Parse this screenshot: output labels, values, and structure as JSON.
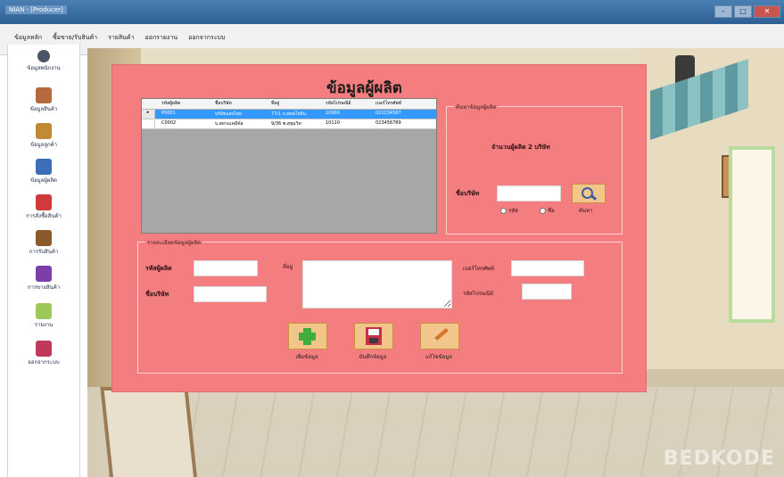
{
  "window": {
    "title": "NIAN - [Producer]",
    "minimize": "–",
    "maximize": "□",
    "close": "✕"
  },
  "menu": [
    "ข้อมูลหลัก",
    "ซื้อขาย/รับสินค้า",
    "รายสินค้า",
    "ออกรายงาน",
    "ออกจากระบบ"
  ],
  "toolbar": [
    {
      "label": "ข้อมูลพนักงาน",
      "icon": "employee-icon",
      "color": "#4b5565"
    },
    {
      "label": "ข้อมูลสินค้า",
      "icon": "product-box-icon",
      "color": "#b46a3c"
    },
    {
      "label": "ข้อมูลลูกค้า",
      "icon": "customer-icon",
      "color": "#c28a35"
    },
    {
      "label": "ข้อมูลผู้ผลิต",
      "icon": "producer-icon",
      "color": "#3d6fb8"
    },
    {
      "label": "การสั่งซื้อสินค้า",
      "icon": "cart-icon",
      "color": "#d13a3a"
    },
    {
      "label": "การรับสินค้า",
      "icon": "receive-icon",
      "color": "#8a5a2a"
    },
    {
      "label": "การขายสินค้า",
      "icon": "sell-icon",
      "color": "#7c3fa8"
    },
    {
      "label": "รายงาน",
      "icon": "report-icon",
      "color": "#9ec85a"
    },
    {
      "label": "ออกจากระบบ",
      "icon": "logout-icon",
      "color": "#c0395a"
    }
  ],
  "form": {
    "title": "ข้อมูลผู้ผลิต",
    "grid": {
      "columns": [
        "รหัสผู้ผลิต",
        "ชื่อบริษัท",
        "ที่อยู่",
        "รหัสไปรษณีย์",
        "เบอร์โทรศัพท์"
      ],
      "rows": [
        [
          "P0001",
          "บริษัทแสงไทย",
          "77/1 ถ.พหลโยธิน",
          "10900",
          "021234567"
        ],
        [
          "C0002",
          "บ.สยามเคมีคัล",
          "9/36 ซ.สุขุมวิท",
          "10110",
          "023456789"
        ]
      ]
    },
    "search": {
      "caption": "ค้นหาข้อมูลผู้ผลิต",
      "count_text": "จำนวนผู้ผลิต 2 บริษัท",
      "company_label": "ชื่อบริษัท",
      "company_value": "",
      "radio_code": "รหัส",
      "radio_name": "ชื่อ",
      "search_label": "ค้นหา"
    },
    "detail": {
      "caption": "รายละเอียดข้อมูลผู้ผลิต",
      "code_label": "รหัสผู้ผลิต",
      "name_label": "ชื่อบริษัท",
      "address_label": "ที่อยู่",
      "phone_label": "เบอร์โทรศัพท์",
      "zip_label": "รหัสไปรษณีย์",
      "code_value": "",
      "name_value": "",
      "address_value": "",
      "phone_value": "",
      "zip_value": ""
    },
    "actions": {
      "add": "เพิ่มข้อมูล",
      "save": "บันทึกข้อมูล",
      "edit": "แก้ไขข้อมูล"
    }
  },
  "watermark": "BEDKODE"
}
